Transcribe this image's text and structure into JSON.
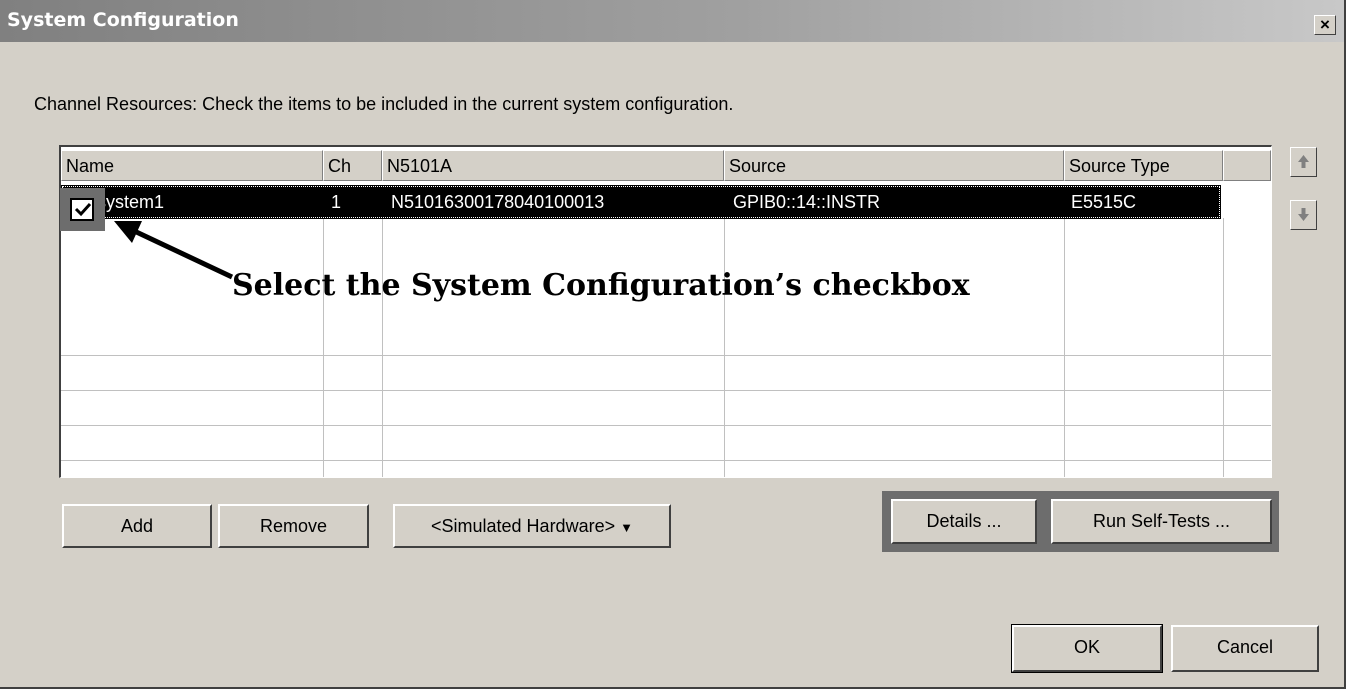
{
  "window": {
    "title": "System Configuration",
    "close_glyph": "×"
  },
  "instructions": "Channel Resources: Check the items to be included in the current system configuration.",
  "table": {
    "columns": [
      "Name",
      "Ch",
      "N5101A",
      "Source",
      "Source Type"
    ],
    "rows": [
      {
        "checked": true,
        "name": "system1",
        "ch": "1",
        "n5101a": "N51016300178040100013",
        "source": "GPIB0::14::INSTR",
        "source_type": "E5515C"
      }
    ]
  },
  "side_buttons": {
    "up_icon": "arrow-up-icon",
    "down_icon": "arrow-down-icon"
  },
  "buttons": {
    "add": "Add",
    "remove": "Remove",
    "hardware": "<Simulated Hardware>",
    "details": "Details ...",
    "self_tests": "Run Self-Tests ...",
    "ok": "OK",
    "cancel": "Cancel"
  },
  "annotation": "Select the System Configuration’s checkbox",
  "colors": {
    "selection": "#000000",
    "highlight": "#6d6d6d",
    "face": "#d4d0c8"
  }
}
